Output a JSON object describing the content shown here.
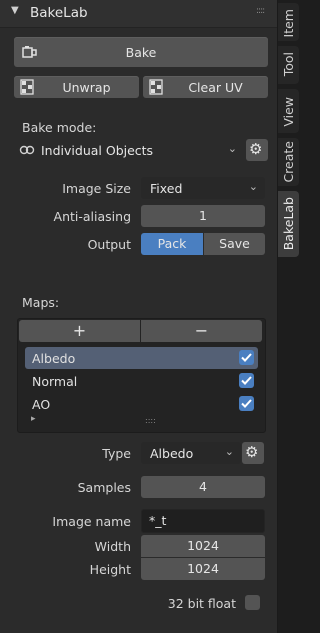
{
  "panel": {
    "title": "BakeLab",
    "grip": "::::"
  },
  "buttons": {
    "bake": "Bake",
    "unwrap": "Unwrap",
    "clear_uv": "Clear UV"
  },
  "bake_mode": {
    "label": "Bake mode:",
    "value": "Individual Objects"
  },
  "image_size": {
    "label": "Image Size",
    "value": "Fixed"
  },
  "anti_aliasing": {
    "label": "Anti-aliasing",
    "value": "1"
  },
  "output": {
    "label": "Output",
    "pack": "Pack",
    "save": "Save",
    "selected": "Pack"
  },
  "maps": {
    "label": "Maps:",
    "add": "+",
    "remove": "−",
    "items": [
      {
        "label": "Albedo",
        "checked": true,
        "selected": true
      },
      {
        "label": "Normal",
        "checked": true,
        "selected": false
      },
      {
        "label": "AO",
        "checked": true,
        "selected": false
      }
    ],
    "expand": "▸",
    "resize_grip": "::::"
  },
  "type": {
    "label": "Type",
    "value": "Albedo"
  },
  "samples": {
    "label": "Samples",
    "value": "4"
  },
  "image_name": {
    "label": "Image name",
    "value": "*_t"
  },
  "width": {
    "label": "Width",
    "value": "1024"
  },
  "height": {
    "label": "Height",
    "value": "1024"
  },
  "float32": {
    "label": "32 bit float",
    "checked": false
  },
  "tabs": [
    "Item",
    "Tool",
    "View",
    "Create",
    "BakeLab"
  ],
  "active_tab": "BakeLab",
  "colors": {
    "accent": "#4a7fc1",
    "panel": "#2b2b2b",
    "button": "#545454"
  }
}
